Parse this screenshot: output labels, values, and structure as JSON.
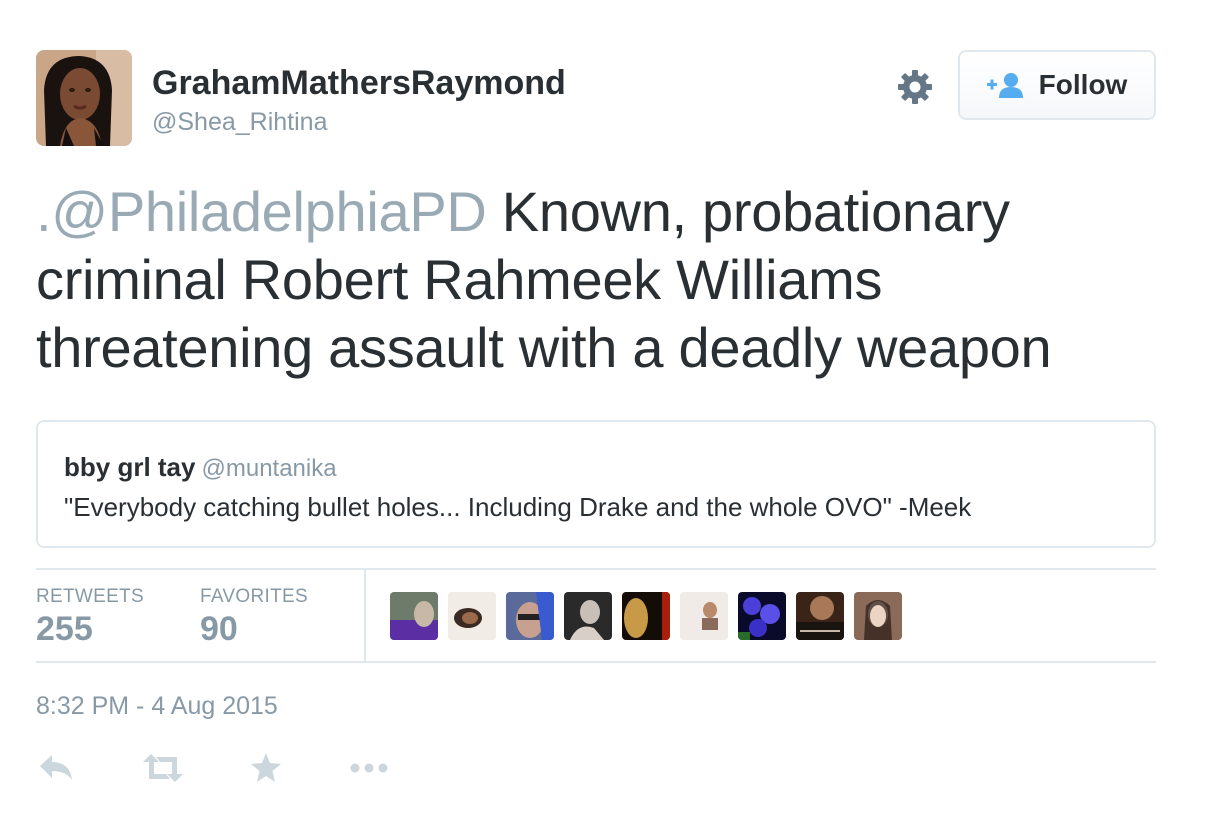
{
  "author": {
    "display_name": "GrahamMathersRaymond",
    "username": "@Shea_Rihtina"
  },
  "follow_button": {
    "label": "Follow"
  },
  "tweet": {
    "prefix": ".",
    "mention": "@PhiladelphiaPD",
    "text": " Known, probationary criminal Robert Rahmeek Williams threatening assault with a deadly weapon"
  },
  "quoted_tweet": {
    "name": "bby grl tay",
    "handle": "@muntanika",
    "text": "\"Everybody catching bullet holes... Including Drake and the whole OVO\" -Meek"
  },
  "stats": {
    "retweets_label": "RETWEETS",
    "retweets": "255",
    "favorites_label": "FAVORITES",
    "favorites": "90"
  },
  "timestamp": "8:32 PM - 4 Aug 2015",
  "actions": [
    "reply-icon",
    "retweet-icon",
    "favorite-icon",
    "more-icon"
  ],
  "colors": {
    "text": "#292f33",
    "muted": "#8899a6",
    "mention": "#99aab5",
    "follow_icon": "#55acee",
    "action_icon": "#ccd6dd",
    "border": "#e1e8ed"
  }
}
